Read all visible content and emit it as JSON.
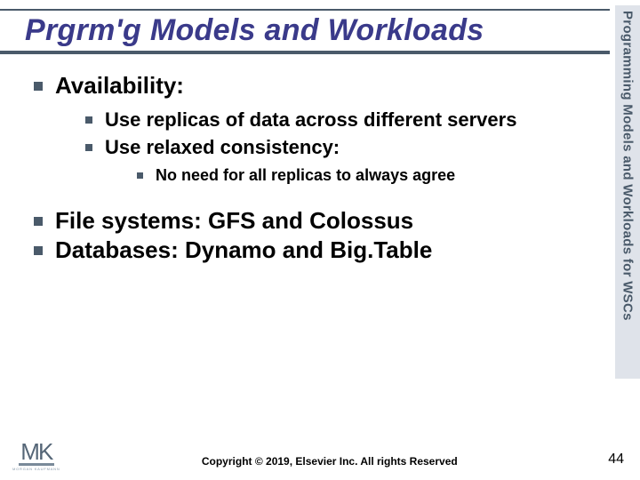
{
  "title": "Prgrm'g Models and Workloads",
  "sidebar_label": "Programming Models and Workloads for WSCs",
  "sections": [
    {
      "heading": "Availability:",
      "items": [
        {
          "text": "Use replicas of data across different servers",
          "sub": []
        },
        {
          "text": "Use relaxed consistency:",
          "sub": [
            {
              "text": "No need for all replicas to always agree"
            }
          ]
        }
      ]
    }
  ],
  "extras": [
    "File systems:  GFS and Colossus",
    "Databases:  Dynamo and Big.Table"
  ],
  "logo": {
    "main": "MK",
    "sub": "MORGAN KAUFMANN"
  },
  "copyright": "Copyright © 2019, Elsevier Inc. All rights Reserved",
  "page_number": "44"
}
